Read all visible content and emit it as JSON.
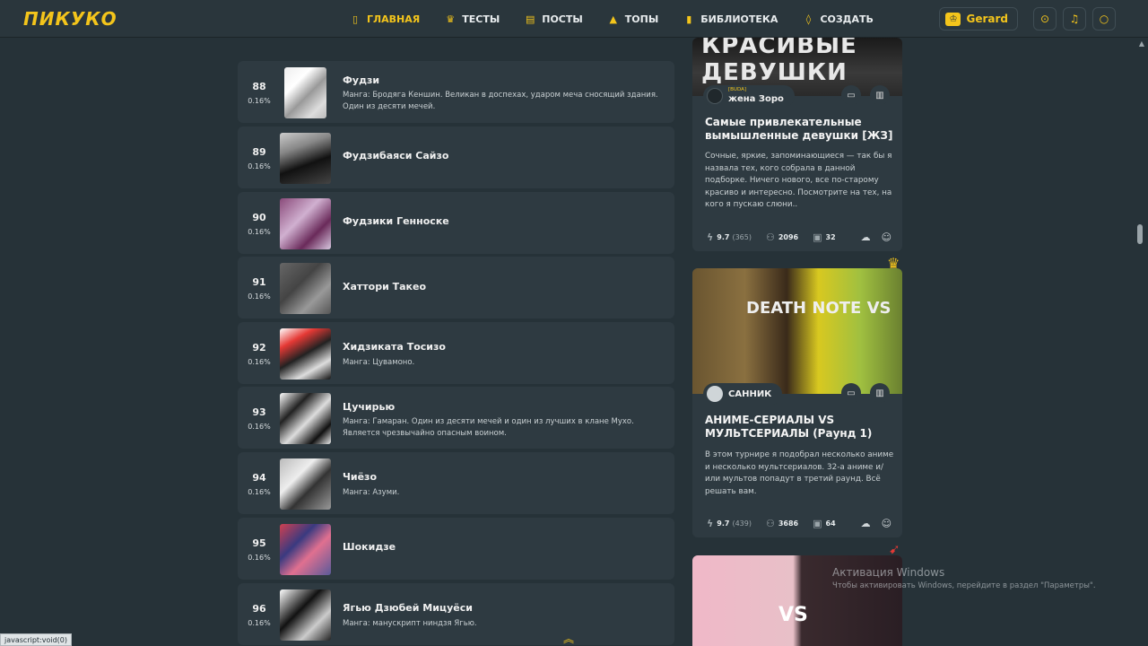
{
  "header": {
    "logo": "ПИКУКО",
    "nav": [
      {
        "label": "ГЛАВНАЯ",
        "icon": "bookmark-icon",
        "active": true
      },
      {
        "label": "ТЕСТЫ",
        "icon": "trophy-icon",
        "active": false
      },
      {
        "label": "ПОСТЫ",
        "icon": "document-icon",
        "active": false
      },
      {
        "label": "ТОПЫ",
        "icon": "podium-icon",
        "active": false
      },
      {
        "label": "БИБЛИОТЕКА",
        "icon": "book-icon",
        "active": false
      },
      {
        "label": "СОЗДАТЬ",
        "icon": "lightbulb-icon",
        "active": false
      }
    ],
    "user": "Gerard"
  },
  "list": {
    "rows": [
      {
        "rank": "88",
        "pct": "0.16%",
        "name": "Фудзи",
        "desc": "Манга: Бродяга Кеншин. Великан в доспехах, ударом меча сносящий здания. Один из десяти мечей."
      },
      {
        "rank": "89",
        "pct": "0.16%",
        "name": "Фудзибаяси Сайзо",
        "desc": ""
      },
      {
        "rank": "90",
        "pct": "0.16%",
        "name": "Фудзики Генноске",
        "desc": ""
      },
      {
        "rank": "91",
        "pct": "0.16%",
        "name": "Хаттори Такео",
        "desc": ""
      },
      {
        "rank": "92",
        "pct": "0.16%",
        "name": "Хидзиката Тосизо",
        "desc": "Манга: Цувамоно."
      },
      {
        "rank": "93",
        "pct": "0.16%",
        "name": "Цучирью",
        "desc": "Манга: Гамаран. Один из десяти мечей и один из лучших в клане Мухо. Является чрезвычайно опасным воином."
      },
      {
        "rank": "94",
        "pct": "0.16%",
        "name": "Чиёзо",
        "desc": "Манга: Азуми."
      },
      {
        "rank": "95",
        "pct": "0.16%",
        "name": "Шокидзе",
        "desc": ""
      },
      {
        "rank": "96",
        "pct": "0.16%",
        "name": "Ягью Дзюбей Мицуёси",
        "desc": "Манга: манускрипт ниндзя Ягью."
      }
    ]
  },
  "cards": [
    {
      "image_text": "КРАСИВЫЕ ДЕВУШКИ",
      "author_tag": "[BUDA]",
      "author": "жена Зоро",
      "title": "Самые привлекательные вымышленные девушки [ЖЗ]",
      "desc": "Сочные, яркие, запоминающиеся — так бы я назвала тех, кого собрала в данной подборке. Ничего нового, все по-старому красиво и интересно. Посмотрите на тех, на кого я пускаю слюни..",
      "rating": "9.7",
      "votes": "365",
      "players": "2096",
      "images": "32"
    },
    {
      "image_text": "DEATH NOTE VS",
      "author": "САННИК",
      "title": "АНИМЕ-СЕРИАЛЫ VS МУЛЬТСЕРИАЛЫ (Раунд 1)",
      "desc": "В этом турнире я подобрал несколько аниме и несколько мультсериалов. 32-а аниме и/или мультов попадут в третий раунд. Всё решать вам.",
      "rating": "9.7",
      "votes": "439",
      "players": "3686",
      "images": "64"
    },
    {
      "image_text": "VS"
    }
  ],
  "status": {
    "url": "javascript:void(0)"
  },
  "watermark": {
    "title": "Активация Windows",
    "subtitle": "Чтобы активировать Windows, перейдите в раздел \"Параметры\"."
  },
  "colors": {
    "accent": "#f4c51b",
    "background": "#263238",
    "card": "#2e3a41"
  }
}
